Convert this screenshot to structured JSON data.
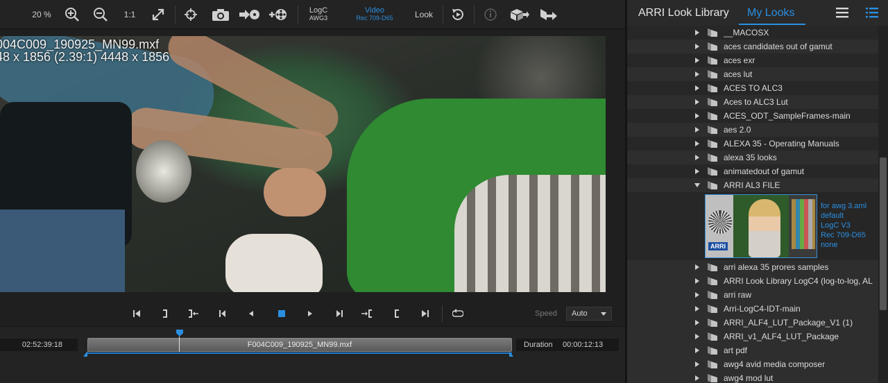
{
  "toolbar": {
    "zoom_level": "20 %",
    "one_to_one": "1:1",
    "input_color": {
      "line1": "LogC",
      "line2": "AWG3"
    },
    "output_color": {
      "line1": "Video",
      "line2": "Rec 709-D65"
    },
    "look_label": "Look"
  },
  "viewer": {
    "clip_name": "004C009_190925_MN99.mxf",
    "clip_resolution": "48 x 1856 (2.39:1)  4448 x 1856"
  },
  "transport": {
    "speed_label": "Speed",
    "speed_value": "Auto"
  },
  "timeline": {
    "timecode_in": "02:52:39:18",
    "clip_label": "F004C009_190925_MN99.mxf",
    "duration_label": "Duration",
    "duration_value": "00:00:12:13"
  },
  "library": {
    "tabs": [
      "ARRI Look Library",
      "My Looks"
    ],
    "active_tab": "My Looks",
    "items_before": [
      {
        "label": "__MACOSX"
      },
      {
        "label": "aces candidates out of gamut"
      },
      {
        "label": "aces exr"
      },
      {
        "label": "aces lut"
      },
      {
        "label": "ACES TO ALC3"
      },
      {
        "label": "Aces to ALC3 Lut"
      },
      {
        "label": "ACES_ODT_SampleFrames-main"
      },
      {
        "label": "aes 2.0"
      },
      {
        "label": "ALEXA 35 - Operating Manuals"
      },
      {
        "label": "alexa 35 looks"
      },
      {
        "label": "animatedout of gamut"
      },
      {
        "label": "ARRI AL3 FILE"
      }
    ],
    "preview": {
      "logo_text": "ARRI",
      "meta": [
        "for awg 3.aml",
        "default",
        "LogC V3",
        "Rec 709-D65",
        "none"
      ]
    },
    "items_after": [
      {
        "label": "arri alexa 35 prores samples"
      },
      {
        "label": "ARRI Look Library LogC4 (log-to-log, AL"
      },
      {
        "label": "arri raw"
      },
      {
        "label": "Arri-LogC4-IDT-main"
      },
      {
        "label": "ARRI_ALF4_LUT_Package_V1 (1)"
      },
      {
        "label": "ARRI_v1_ALF4_LUT_Package"
      },
      {
        "label": "art pdf"
      },
      {
        "label": "awg4 avid media composer"
      },
      {
        "label": "awg4 mod lut"
      }
    ]
  },
  "colors": {
    "accent": "#2b8fe0",
    "background": "#1e1e1e",
    "panel": "#272727"
  }
}
